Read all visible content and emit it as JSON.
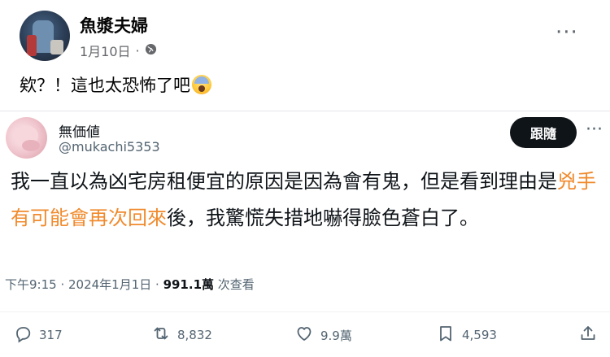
{
  "fb_post": {
    "author": "魚漿夫婦",
    "date": "1月10日",
    "separator": "·",
    "text": "欸？！這也太恐怖了吧",
    "emoji": "fearful-face-emoji"
  },
  "tweet": {
    "display_name": "無価値",
    "handle": "@mukachi5353",
    "follow_label": "跟隨",
    "text_before": "我一直以為凶宅房租便宜的原因是因為會有鬼，但是看到理由是",
    "text_highlight": "兇手有可能會再次回來",
    "text_after": "後，我驚慌失措地嚇得臉色蒼白了。",
    "highlight_color": "#f08a2c",
    "meta_time": "下午9:15 · 2024年1月1日 · ",
    "views_count": "991.1萬",
    "views_label": " 次查看",
    "replies": "317",
    "retweets": "8,832",
    "likes": "9.9萬",
    "bookmarks": "4,593"
  }
}
